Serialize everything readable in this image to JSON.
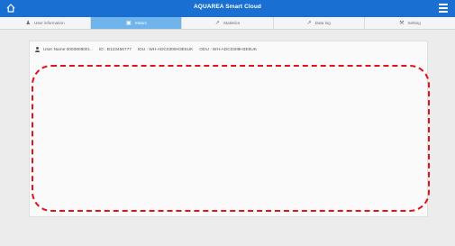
{
  "header": {
    "title": "AQUAREA Smart Cloud",
    "home_icon": "home-icon",
    "menu_icon": "hamburger-menu-icon",
    "bar_color": "#1a6fd2"
  },
  "tabs": [
    {
      "label": "User information",
      "icon": "person-icon",
      "active": false
    },
    {
      "label": "Status",
      "icon": "monitor-icon",
      "active": true
    },
    {
      "label": "Statistics",
      "icon": "chart-icon",
      "active": false
    },
    {
      "label": "Data log",
      "icon": "data-log-icon",
      "active": false
    },
    {
      "label": "Setting",
      "icon": "wrench-icon",
      "active": false
    }
  ],
  "info": {
    "user": "User Name 000080800I...",
    "id": "ID : B123456777",
    "idu": "IDU : WH-ADC0309H3E5UK",
    "odu": "ODU : WH-ADC0309H3E5UK"
  },
  "highlight_color": "#e0131d",
  "active_tab_color": "#6fb4ea"
}
